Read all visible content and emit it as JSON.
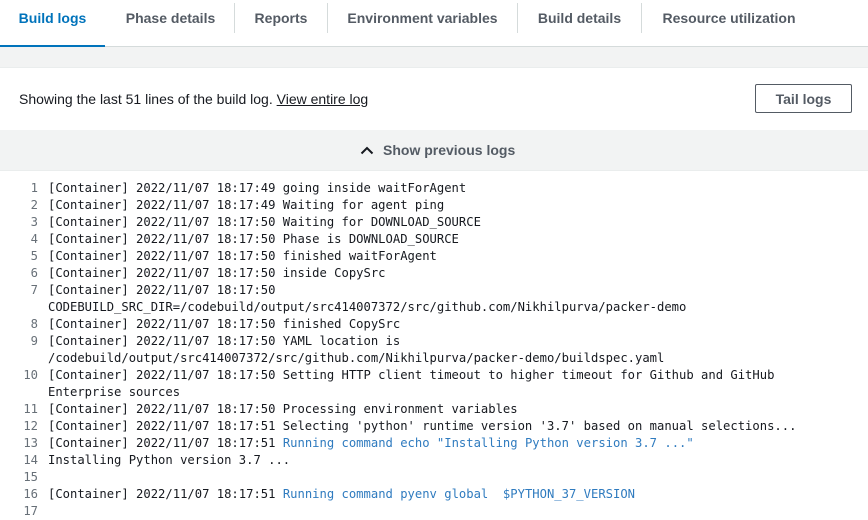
{
  "tabs": [
    {
      "label": "Build logs"
    },
    {
      "label": "Phase details"
    },
    {
      "label": "Reports"
    },
    {
      "label": "Environment variables"
    },
    {
      "label": "Build details"
    },
    {
      "label": "Resource utilization"
    }
  ],
  "info": {
    "text": "Showing the last 51 lines of the build log.",
    "link": "View entire log",
    "tail_button": "Tail logs"
  },
  "previous": {
    "label": "Show previous logs"
  },
  "colors": {
    "accent": "#0073bb",
    "command": "#2f7bbf"
  },
  "log_lines": [
    {
      "num": "1",
      "text": "[Container] 2022/11/07 18:17:49 going inside waitForAgent",
      "cmd": ""
    },
    {
      "num": "2",
      "text": "[Container] 2022/11/07 18:17:49 Waiting for agent ping",
      "cmd": ""
    },
    {
      "num": "3",
      "text": "[Container] 2022/11/07 18:17:50 Waiting for DOWNLOAD_SOURCE",
      "cmd": ""
    },
    {
      "num": "4",
      "text": "[Container] 2022/11/07 18:17:50 Phase is DOWNLOAD_SOURCE",
      "cmd": ""
    },
    {
      "num": "5",
      "text": "[Container] 2022/11/07 18:17:50 finished waitForAgent",
      "cmd": ""
    },
    {
      "num": "6",
      "text": "[Container] 2022/11/07 18:17:50 inside CopySrc",
      "cmd": ""
    },
    {
      "num": "7",
      "text": "[Container] 2022/11/07 18:17:50\nCODEBUILD_SRC_DIR=/codebuild/output/src414007372/src/github.com/Nikhilpurva/packer-demo",
      "cmd": ""
    },
    {
      "num": "8",
      "text": "[Container] 2022/11/07 18:17:50 finished CopySrc",
      "cmd": ""
    },
    {
      "num": "9",
      "text": "[Container] 2022/11/07 18:17:50 YAML location is\n/codebuild/output/src414007372/src/github.com/Nikhilpurva/packer-demo/buildspec.yaml",
      "cmd": ""
    },
    {
      "num": "10",
      "text": "[Container] 2022/11/07 18:17:50 Setting HTTP client timeout to higher timeout for Github and GitHub\nEnterprise sources",
      "cmd": ""
    },
    {
      "num": "11",
      "text": "[Container] 2022/11/07 18:17:50 Processing environment variables",
      "cmd": ""
    },
    {
      "num": "12",
      "text": "[Container] 2022/11/07 18:17:51 Selecting 'python' runtime version '3.7' based on manual selections...",
      "cmd": ""
    },
    {
      "num": "13",
      "text": "[Container] 2022/11/07 18:17:51 ",
      "cmd": "Running command echo \"Installing Python version 3.7 ...\""
    },
    {
      "num": "14",
      "text": "Installing Python version 3.7 ...",
      "cmd": ""
    },
    {
      "num": "15",
      "text": "",
      "cmd": ""
    },
    {
      "num": "16",
      "text": "[Container] 2022/11/07 18:17:51 ",
      "cmd": "Running command pyenv global  $PYTHON_37_VERSION"
    },
    {
      "num": "17",
      "text": "",
      "cmd": ""
    }
  ]
}
